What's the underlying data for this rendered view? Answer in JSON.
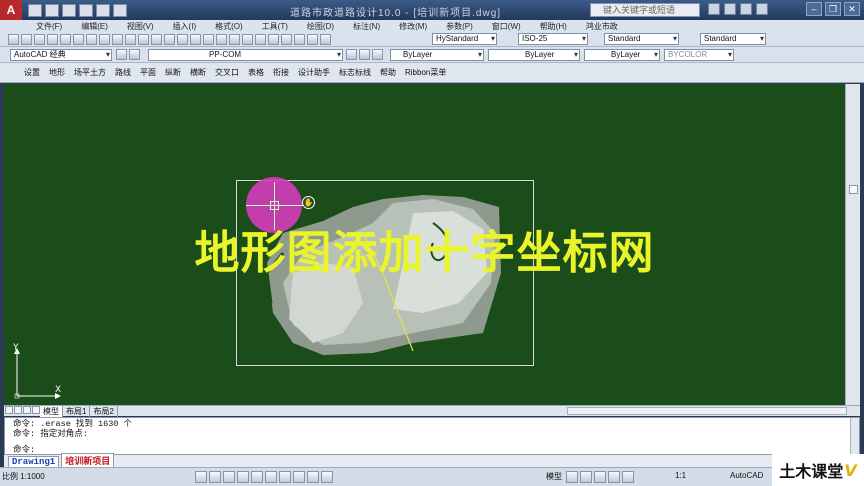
{
  "window": {
    "title": "道路市政道路设计10.0 - [培训新项目.dwg]",
    "search_placeholder": "键入关键字或短语"
  },
  "menu": [
    "文件(F)",
    "编辑(E)",
    "视图(V)",
    "插入(I)",
    "格式(O)",
    "工具(T)",
    "绘图(D)",
    "标注(N)",
    "修改(M)",
    "参数(P)",
    "窗口(W)",
    "帮助(H)",
    "鸿业市政"
  ],
  "toolbar1": {
    "text_style": "HyStandard",
    "dim_style": "ISO-25",
    "table_style": "Standard",
    "multileader_style": "Standard"
  },
  "toolbar2": {
    "workspace": "AutoCAD 经典",
    "layer": "PP-COM",
    "color": "ByLayer",
    "linetype": "ByLayer",
    "lineweight": "ByLayer",
    "plotstyle": "BYCOLOR"
  },
  "custom_menu": [
    "设置",
    "地形",
    "场平土方",
    "路线",
    "平面",
    "纵断",
    "横断",
    "交叉口",
    "表格",
    "衔接",
    "设计助手",
    "标志标线",
    "帮助",
    "Ribbon菜单"
  ],
  "overlay_title": "地形图添加十字坐标网",
  "ucs": {
    "x": "X",
    "y": "Y"
  },
  "layout_tabs": [
    "模型",
    "布局1",
    "布局2"
  ],
  "command_lines": [
    "命令:  .erase 找到 1630 个",
    "命令:  指定对角点:",
    "",
    "命令:"
  ],
  "doc_tabs": [
    "Drawing1",
    "培训新项目"
  ],
  "status": {
    "scale": "比例 1:1000",
    "model_label": "模型",
    "annotation_scale": "1:1",
    "product": "AutoCAD"
  },
  "watermark": {
    "text": "土木课堂",
    "suffix": "V"
  },
  "colors": {
    "canvas": "#1a4d1a",
    "overlay_text": "#e9f52a",
    "cursor": "#d63cbe"
  }
}
